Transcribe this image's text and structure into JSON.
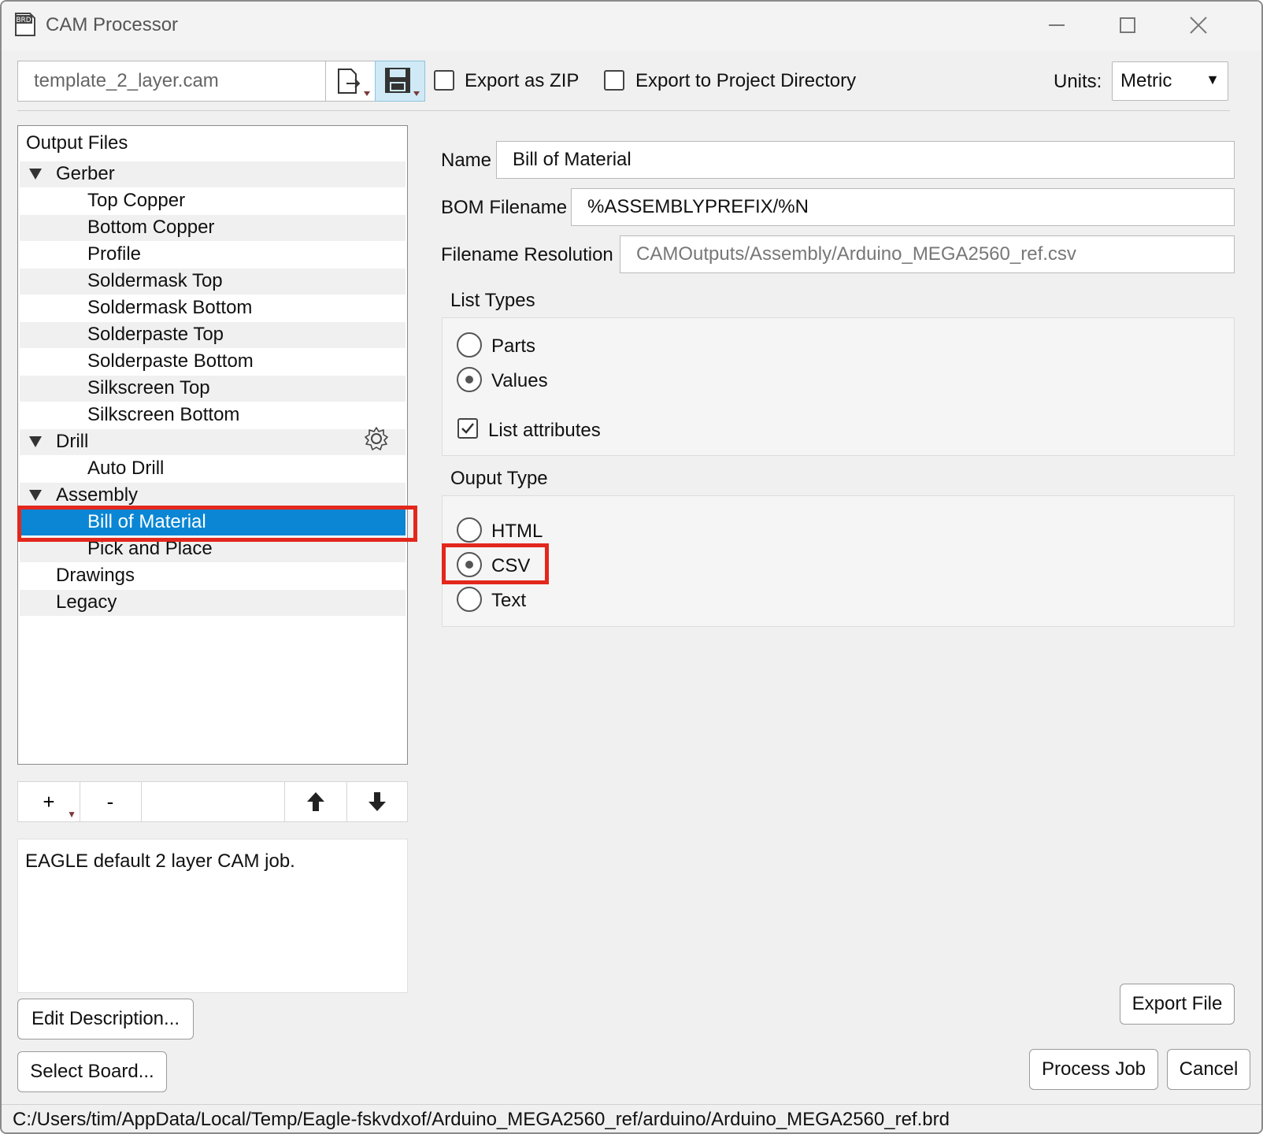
{
  "window": {
    "title": "CAM Processor",
    "app_icon_text": "BRD"
  },
  "toolbar": {
    "job_file": "template_2_layer.cam",
    "export_zip_label": "Export as ZIP",
    "export_zip_checked": false,
    "export_project_label": "Export to Project Directory",
    "export_project_checked": false,
    "units_label": "Units:",
    "units_value": "Metric"
  },
  "tree": {
    "header": "Output Files",
    "items": [
      {
        "label": "Gerber",
        "level": 0,
        "expanded": true
      },
      {
        "label": "Top Copper",
        "level": 1
      },
      {
        "label": "Bottom Copper",
        "level": 1
      },
      {
        "label": "Profile",
        "level": 1
      },
      {
        "label": "Soldermask Top",
        "level": 1
      },
      {
        "label": "Soldermask Bottom",
        "level": 1
      },
      {
        "label": "Solderpaste Top",
        "level": 1
      },
      {
        "label": "Solderpaste Bottom",
        "level": 1
      },
      {
        "label": "Silkscreen Top",
        "level": 1
      },
      {
        "label": "Silkscreen Bottom",
        "level": 1
      },
      {
        "label": "Drill",
        "level": 0,
        "expanded": true
      },
      {
        "label": "Auto Drill",
        "level": 1
      },
      {
        "label": "Assembly",
        "level": 0,
        "expanded": true
      },
      {
        "label": "Bill of Material",
        "level": 1,
        "selected": true
      },
      {
        "label": "Pick and Place",
        "level": 1
      },
      {
        "label": "Drawings",
        "level": 0
      },
      {
        "label": "Legacy",
        "level": 0
      }
    ],
    "buttons": {
      "add": "+",
      "remove": "-"
    }
  },
  "description": "EAGLE default 2 layer CAM job.",
  "left_buttons": {
    "edit_description": "Edit Description...",
    "select_board": "Select Board..."
  },
  "form": {
    "name_label": "Name",
    "name_value": "Bill of Material",
    "bom_label": "BOM Filename",
    "bom_value": "%ASSEMBLYPREFIX/%N",
    "resolution_label": "Filename Resolution",
    "resolution_value": "CAMOutputs/Assembly/Arduino_MEGA2560_ref.csv"
  },
  "list_types": {
    "title": "List Types",
    "options": [
      "Parts",
      "Values"
    ],
    "selected": "Values",
    "list_attributes_label": "List attributes",
    "list_attributes_checked": true
  },
  "output_type": {
    "title": "Ouput Type",
    "options": [
      "HTML",
      "CSV",
      "Text"
    ],
    "selected": "CSV"
  },
  "actions": {
    "export_file": "Export File",
    "process_job": "Process Job",
    "cancel": "Cancel"
  },
  "status_path": "C:/Users/tim/AppData/Local/Temp/Eagle-fskvdxof/Arduino_MEGA2560_ref/arduino/Arduino_MEGA2560_ref.brd",
  "colors": {
    "selection": "#0a86d4",
    "highlight": "#e3271c"
  }
}
